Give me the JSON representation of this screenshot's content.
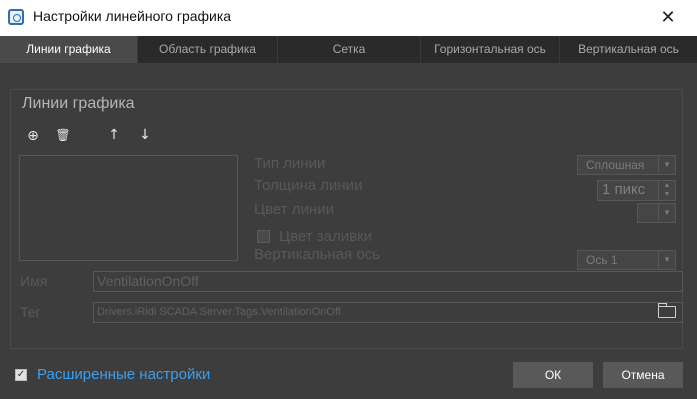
{
  "window": {
    "title": "Настройки линейного графика",
    "close": "✕"
  },
  "tabs": [
    {
      "label": "Линии графика"
    },
    {
      "label": "Область графика"
    },
    {
      "label": "Сетка"
    },
    {
      "label": "Горизонтальная ось"
    },
    {
      "label": "Вертикальная ось"
    }
  ],
  "group": {
    "title": "Линии графика"
  },
  "toolbar": {
    "add": "⊕",
    "delete": "🗑",
    "up": "↑",
    "down": "↓"
  },
  "props": {
    "line_type_label": "Тип линии",
    "line_type_value": "Сплошная",
    "thickness_label": "Толщина линии",
    "thickness_value": "1 пикс",
    "color_label": "Цвет линии",
    "fill_label": "Цвет заливки",
    "vaxis_label": "Вертикальная ось",
    "vaxis_value": "Ось 1"
  },
  "fields": {
    "name_label": "Имя",
    "name_value": "VentilationOnOff",
    "tag_label": "Тег",
    "tag_value": "Drivers.iRidi SCADA Server.Tags.VentilationOnOff"
  },
  "footer": {
    "advanced_label": "Расширенные настройки",
    "ok_label": "ОК",
    "cancel_label": "Отмена"
  },
  "colors": {
    "accent_link": "#3b9ef0",
    "bg": "#3d3d3d"
  }
}
